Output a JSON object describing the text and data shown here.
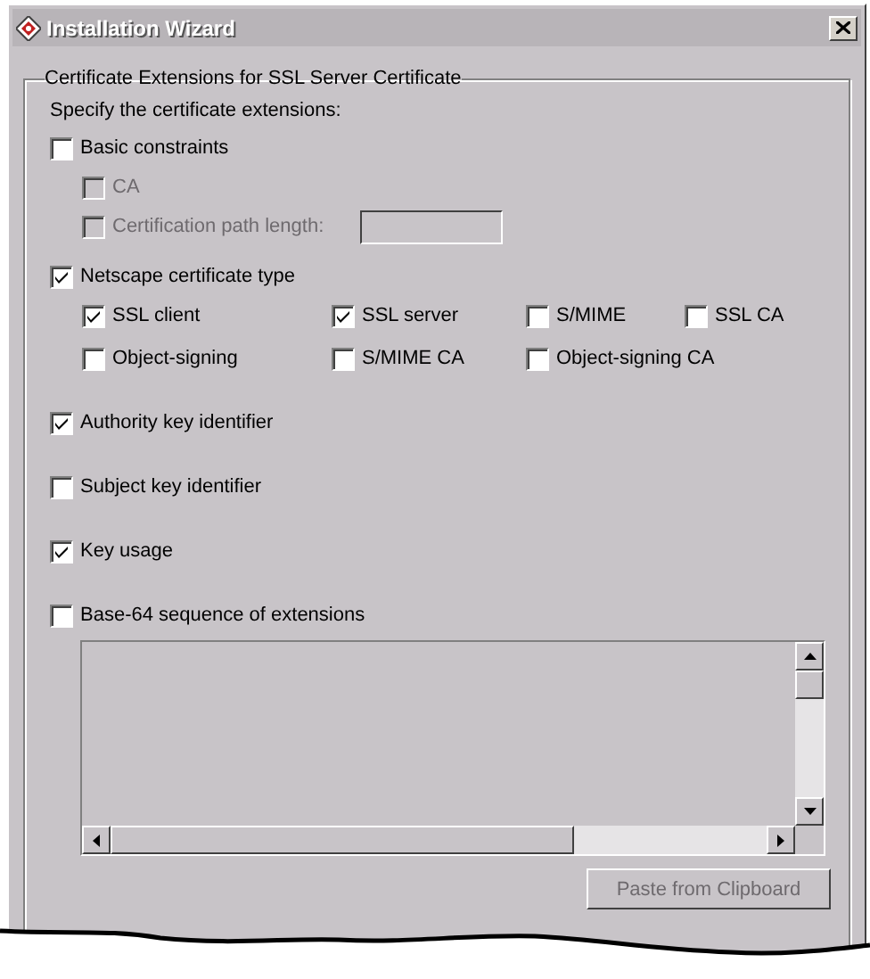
{
  "window": {
    "title": "Installation Wizard"
  },
  "group": {
    "title": "Certificate Extensions for SSL Server Certificate",
    "instruction": "Specify the certificate extensions:"
  },
  "extensions": [
    {
      "kind": "column",
      "label": "Basic constraints",
      "checked": false,
      "options": [
        {
          "label": "CA",
          "checked": false,
          "disabled": true
        },
        {
          "label": "Certification path length:",
          "checked": false,
          "disabled": true,
          "field": {
            "disabled": true
          }
        }
      ]
    },
    {
      "kind": "grid",
      "label": "Netscape certificate type",
      "checked": true,
      "options": [
        {
          "label": "SSL client",
          "checked": true,
          "disabled": false
        },
        {
          "label": "SSL server",
          "checked": true,
          "disabled": false
        },
        {
          "label": "S/MIME",
          "checked": false,
          "disabled": false
        },
        {
          "label": "SSL CA",
          "checked": false,
          "disabled": false
        },
        {
          "label": "Object-signing",
          "checked": false,
          "disabled": false
        },
        {
          "label": "S/MIME CA",
          "checked": false,
          "disabled": false
        },
        {
          "label": "Object-signing CA",
          "checked": false,
          "disabled": false
        }
      ]
    },
    {
      "kind": "plain",
      "label": "Authority key identifier",
      "checked": true
    },
    {
      "kind": "plain",
      "label": "Subject key identifier",
      "checked": false
    },
    {
      "kind": "plain",
      "label": "Key usage",
      "checked": true
    },
    {
      "kind": "text-area",
      "label": "Base-64 sequence of extensions",
      "checked": false,
      "text_area": {
        "disabled": true
      }
    }
  ],
  "button": {
    "label": "Paste from Clipboard",
    "disabled": true
  }
}
